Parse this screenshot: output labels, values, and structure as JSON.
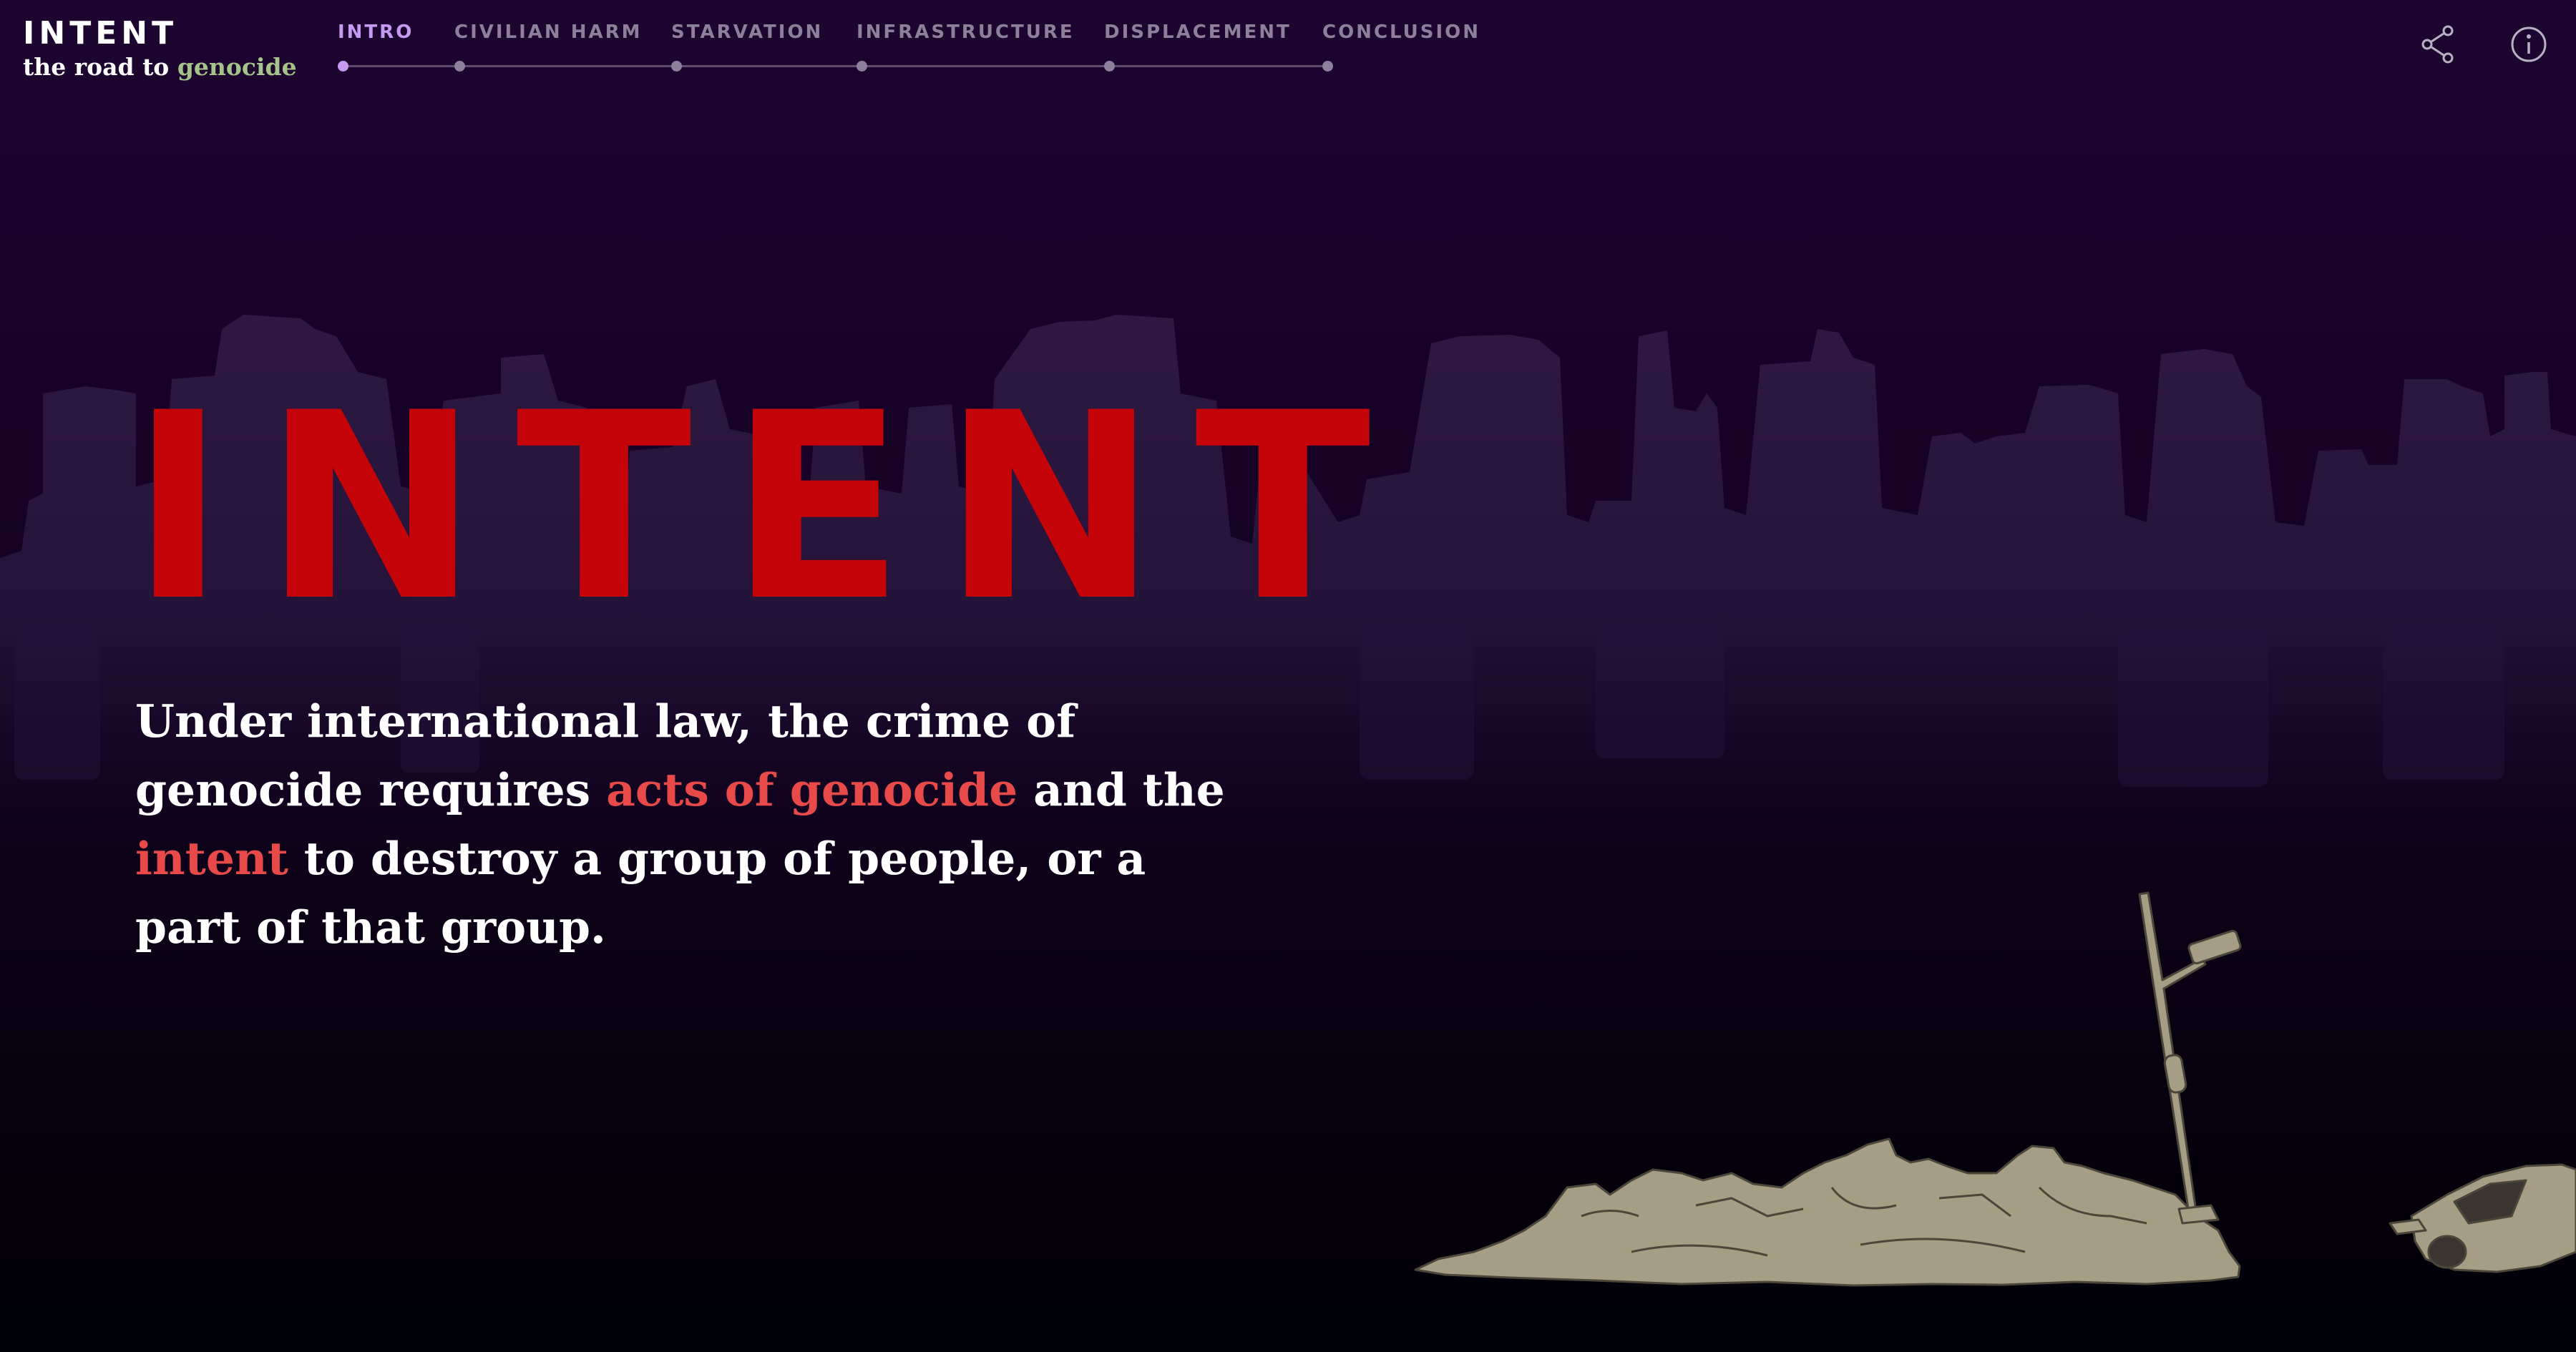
{
  "logo": {
    "title": "INTENT",
    "subtitle_prefix": "the road to ",
    "subtitle_accent": "genocide"
  },
  "nav": {
    "items": [
      {
        "label": "INTRO",
        "active": true
      },
      {
        "label": "CIVILIAN HARM",
        "active": false
      },
      {
        "label": "STARVATION",
        "active": false
      },
      {
        "label": "INFRASTRUCTURE",
        "active": false
      },
      {
        "label": "DISPLACEMENT",
        "active": false
      },
      {
        "label": "CONCLUSION",
        "active": false
      }
    ]
  },
  "actions": {
    "share_icon": "share-icon",
    "info_icon": "info-icon"
  },
  "hero": {
    "title": "INTENT",
    "text_part1": "Under international law, the crime of genocide requires ",
    "highlight1": "acts of genocide",
    "text_part2": " and the ",
    "highlight2": "intent",
    "text_part3": " to destroy a group of people, or a part of that group."
  },
  "colors": {
    "title_red": "#c40408",
    "highlight_red": "#e84a4a",
    "nav_active": "#c79af2",
    "nav_inactive": "#8c809a",
    "logo_accent": "#a6c48a",
    "background_top": "#1d0530",
    "background_bottom": "#010006"
  }
}
